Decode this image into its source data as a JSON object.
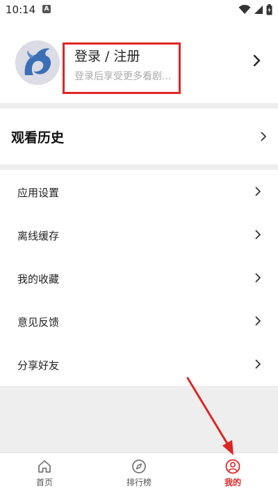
{
  "status_bar": {
    "time": "10:14",
    "notification_glyph": "A",
    "icons": [
      "wifi-icon",
      "signal-icon",
      "battery-icon"
    ]
  },
  "profile": {
    "avatar_icon": "dragon-logo-avatar",
    "title": "登录 / 注册",
    "subtitle": "登录后享受更多看剧..."
  },
  "history": {
    "label": "观看历史"
  },
  "menu": {
    "items": [
      {
        "label": "应用设置"
      },
      {
        "label": "离线缓存"
      },
      {
        "label": "我的收藏"
      },
      {
        "label": "意见反馈"
      },
      {
        "label": "分享好友"
      }
    ]
  },
  "tabbar": {
    "tabs": [
      {
        "label": "首页",
        "icon": "home-icon"
      },
      {
        "label": "排行榜",
        "icon": "compass-icon"
      },
      {
        "label": "我的",
        "icon": "user-icon",
        "active": true
      }
    ]
  },
  "colors": {
    "accent": "#e02424",
    "divider": "#eeeeee",
    "muted_text": "#aaaaaa"
  }
}
